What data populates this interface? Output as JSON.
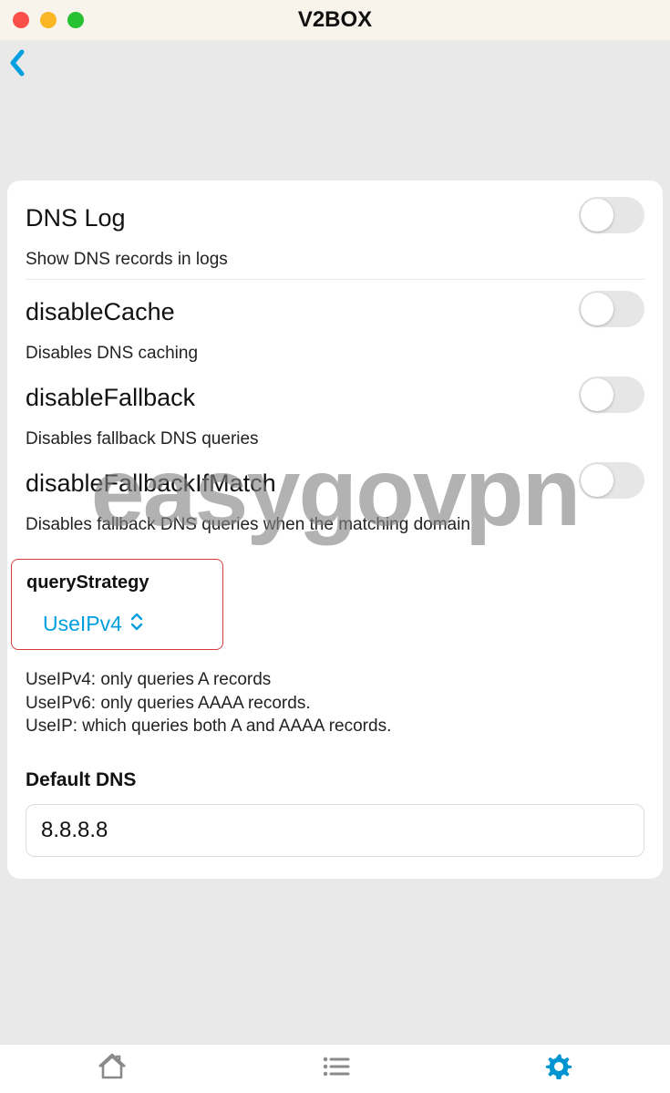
{
  "app": {
    "title": "V2BOX"
  },
  "watermark": "easygovpn",
  "settings": {
    "dnsLog": {
      "title": "DNS Log",
      "desc": "Show DNS records in logs",
      "on": false
    },
    "disableCache": {
      "title": "disableCache",
      "desc": "Disables DNS caching",
      "on": false
    },
    "disableFallback": {
      "title": "disableFallback",
      "desc": "Disables fallback DNS queries",
      "on": false
    },
    "disableFallbackIfMatch": {
      "title": "disableFallbackIfMatch",
      "desc": "Disables fallback DNS queries when the matching domain",
      "on": false
    },
    "queryStrategy": {
      "label": "queryStrategy",
      "value": "UseIPv4",
      "help1": "UseIPv4: only queries A records",
      "help2": "UseIPv6: only queries AAAA records.",
      "help3": "UseIP: which queries both A and AAAA records."
    },
    "defaultDns": {
      "label": "Default DNS",
      "value": "8.8.8.8"
    }
  }
}
